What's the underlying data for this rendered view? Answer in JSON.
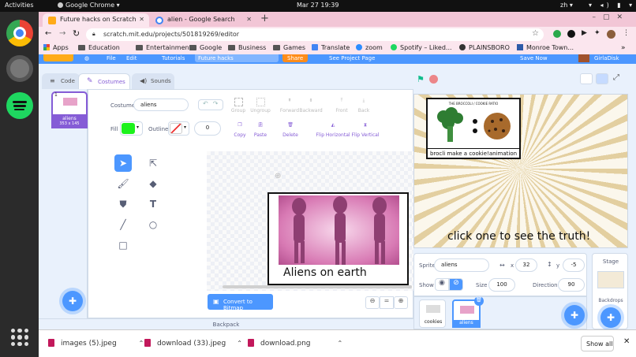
{
  "os": {
    "activities": "Activities",
    "app_name": "Google Chrome",
    "clock": "Mar 27  19:39",
    "lang": "zh"
  },
  "browser": {
    "tabs": [
      {
        "label": "Future hacks on Scratch",
        "active": true
      },
      {
        "label": "alien - Google Search",
        "active": false
      }
    ],
    "url": "scratch.mit.edu/projects/501819269/editor",
    "bookmarks": [
      "Apps",
      "Education",
      "Entertainment",
      "Google",
      "Business",
      "Games",
      "Translate",
      "zoom",
      "Spotify – Liked...",
      "PLAINSBORO",
      "Monroe Town..."
    ]
  },
  "scratch": {
    "menu": {
      "file": "File",
      "edit": "Edit",
      "tutorials": "Tutorials",
      "project_title": "Future hacks",
      "share": "Share",
      "see_project_page": "See Project Page",
      "save_now": "Save Now",
      "username": "GirlaDisk"
    },
    "tabs": {
      "code": "Code",
      "costumes": "Costumes",
      "sounds": "Sounds"
    },
    "costume_list": [
      {
        "index": "1",
        "name": "aliens",
        "size": "353 x 145"
      }
    ],
    "paint": {
      "costume_label": "Costume",
      "costume_name": "aliens",
      "fill_label": "Fill",
      "fill_color": "#1cf21c",
      "outline_label": "Outline",
      "outline_width": "0",
      "tools_row1": [
        "Group",
        "Ungroup",
        "Forward",
        "Backward",
        "Front",
        "Back"
      ],
      "tools_row2": [
        "Copy",
        "Paste",
        "Delete",
        "Flip Horizontal",
        "Flip Vertical"
      ],
      "canvas_caption": "Aliens on earth",
      "convert_button": "Convert to Bitmap",
      "zoom_reset": "="
    },
    "backpack": "Backpack",
    "stage": {
      "title_small": "THE BROCCOLI / COOKIE RATIO",
      "banner": "brocli make a cookie!animation",
      "caption": "click one to see the truth!"
    },
    "sprite_info": {
      "sprite_label": "Sprite",
      "sprite_name": "aliens",
      "x_label": "x",
      "x_value": "32",
      "y_label": "y",
      "y_value": "-5",
      "show_label": "Show",
      "size_label": "Size",
      "size_value": "100",
      "direction_label": "Direction",
      "direction_value": "90"
    },
    "sprites": [
      {
        "name": "cookies"
      },
      {
        "name": "aliens",
        "selected": true
      }
    ],
    "stage_side": {
      "label": "Stage",
      "backdrops_label": "Backdrops"
    }
  },
  "downloads": {
    "items": [
      "images (5).jpeg",
      "download (33).jpeg",
      "download.png"
    ],
    "show_all": "Show all"
  },
  "colors": {
    "scratch_blue": "#4c97ff",
    "scratch_purple": "#855cd6",
    "tab_strip": "#f2c6d6",
    "share_orange": "#ff8c1a"
  }
}
